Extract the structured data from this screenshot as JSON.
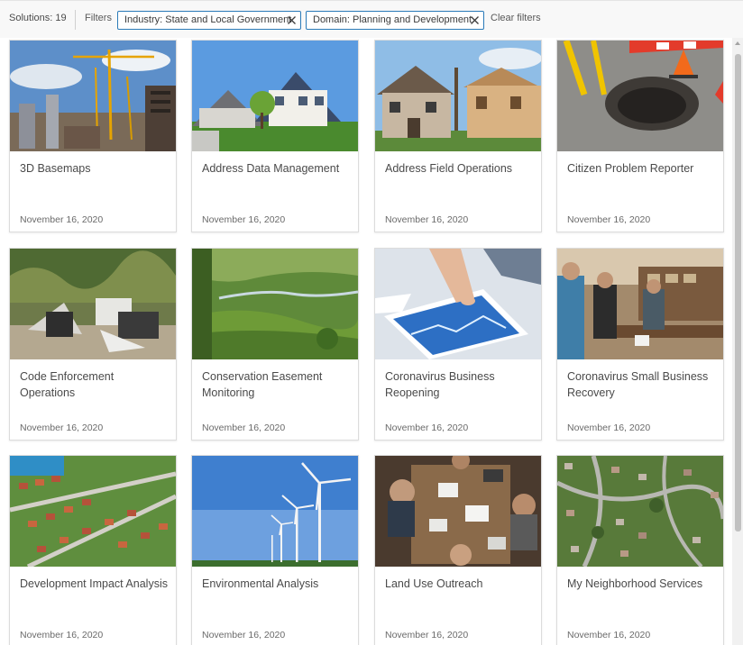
{
  "filterbar": {
    "solutions_count": "Solutions: 19",
    "filters_label": "Filters",
    "chips": [
      {
        "label": "Industry: State and Local Government",
        "icon": "close-icon"
      },
      {
        "label": "Domain: Planning and Development",
        "icon": "close-icon"
      }
    ],
    "clear_label": "Clear filters"
  },
  "cards": [
    {
      "title": "3D Basemaps",
      "date": "November 16, 2020",
      "image": "construction-cranes"
    },
    {
      "title": "Address Data Management",
      "date": "November 16, 2020",
      "image": "suburban-houses"
    },
    {
      "title": "Address Field Operations",
      "date": "November 16, 2020",
      "image": "houses-under-construction"
    },
    {
      "title": "Citizen Problem Reporter",
      "date": "November 16, 2020",
      "image": "pothole-with-cones"
    },
    {
      "title": "Code Enforcement Operations",
      "date": "November 16, 2020",
      "image": "illegal-dumping"
    },
    {
      "title": "Conservation Easement Monitoring",
      "date": "November 16, 2020",
      "image": "green-valley"
    },
    {
      "title": "Coronavirus Business Reopening",
      "date": "November 16, 2020",
      "image": "tablet-chart"
    },
    {
      "title": "Coronavirus Small Business Recovery",
      "date": "November 16, 2020",
      "image": "cafe-interior"
    },
    {
      "title": "Development Impact Analysis",
      "date": "November 16, 2020",
      "image": "aerial-subdivision"
    },
    {
      "title": "Environmental Analysis",
      "date": "November 16, 2020",
      "image": "wind-turbines"
    },
    {
      "title": "Land Use Outreach",
      "date": "November 16, 2020",
      "image": "meeting-table"
    },
    {
      "title": "My Neighborhood Services",
      "date": "November 16, 2020",
      "image": "aerial-neighborhood"
    }
  ]
}
